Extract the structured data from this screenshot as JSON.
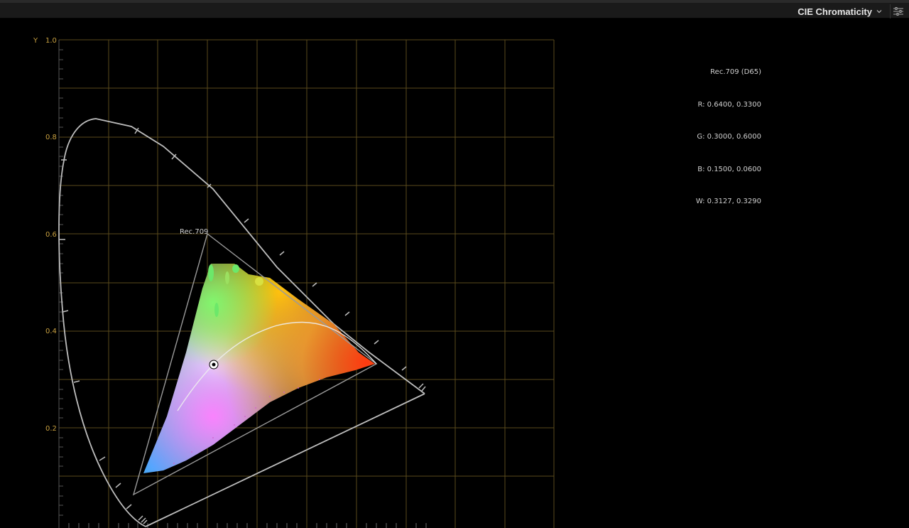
{
  "toolbar": {
    "scope_label": "CIE Chromaticity",
    "dropdown_icon": "chevron-down-icon",
    "options_icon": "sliders-icon"
  },
  "axis": {
    "y_axis_label": "Y",
    "y_ticks": [
      "1.0",
      "0.8",
      "0.6",
      "0.4",
      "0.2"
    ],
    "grid_color": "#5a4a1c",
    "tick_label_color": "#c8a040"
  },
  "gamut": {
    "label": "Rec.709",
    "primaries": {
      "r": [
        0.64,
        0.33
      ],
      "g": [
        0.3,
        0.6
      ],
      "b": [
        0.15,
        0.06
      ]
    },
    "white_point": [
      0.3127,
      0.329
    ]
  },
  "readout": {
    "title": "Rec.709 (D65)",
    "r": "R: 0.6400, 0.3300",
    "g": "G: 0.3000, 0.6000",
    "b": "B: 0.1500, 0.0600",
    "w": "W: 0.3127, 0.3290"
  }
}
